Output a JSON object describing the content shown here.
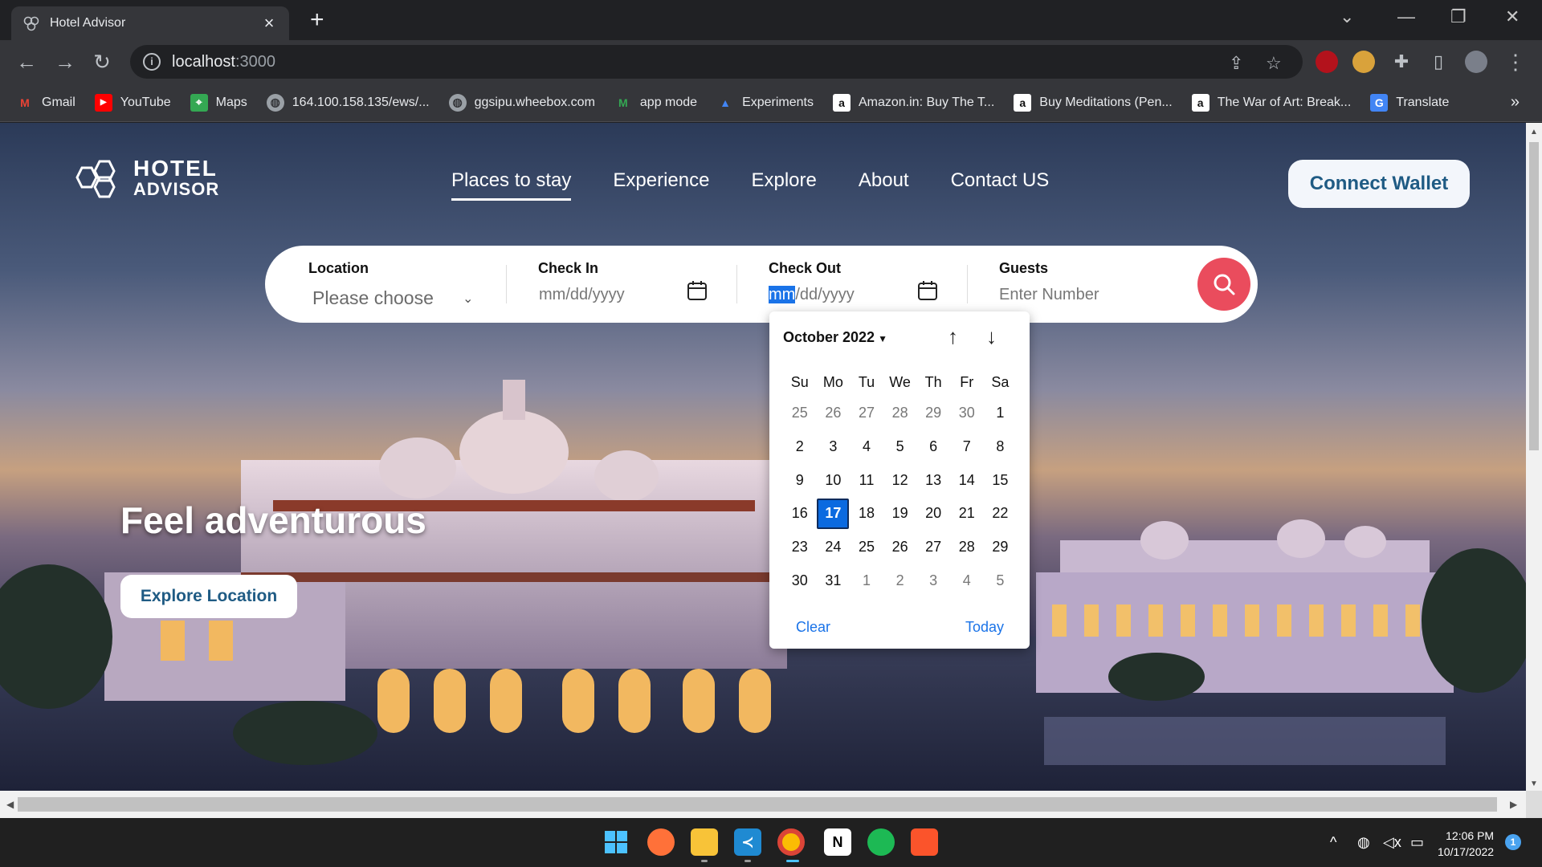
{
  "browser": {
    "tab_title": "Hotel Advisor",
    "url_host": "localhost",
    "url_port": ":3000",
    "bookmarks": [
      {
        "label": "Gmail",
        "icon": "gmail-icon"
      },
      {
        "label": "YouTube",
        "icon": "youtube-icon"
      },
      {
        "label": "Maps",
        "icon": "maps-icon"
      },
      {
        "label": "164.100.158.135/ews/...",
        "icon": "globe-icon"
      },
      {
        "label": "ggsipu.wheebox.com",
        "icon": "globe-icon"
      },
      {
        "label": "app mode",
        "icon": "app-mode-icon"
      },
      {
        "label": "Experiments",
        "icon": "experiments-icon"
      },
      {
        "label": "Amazon.in: Buy The T...",
        "icon": "amazon-icon"
      },
      {
        "label": "Buy Meditations (Pen...",
        "icon": "amazon-icon"
      },
      {
        "label": "The War of Art: Break...",
        "icon": "amazon-icon"
      },
      {
        "label": "Translate",
        "icon": "translate-icon"
      }
    ]
  },
  "site": {
    "logo_line1": "HOTEL",
    "logo_line2": "ADVISOR",
    "nav": [
      "Places to stay",
      "Experience",
      "Explore",
      "About",
      "Contact US"
    ],
    "active_nav": "Places to stay",
    "connect_wallet": "Connect Wallet"
  },
  "search": {
    "location_label": "Location",
    "location_value": "Please choose",
    "checkin_label": "Check In",
    "checkin_value": "mm/dd/yyyy",
    "checkout_label": "Check Out",
    "checkout_mm": "mm",
    "checkout_rest": "/dd/yyyy",
    "guests_label": "Guests",
    "guests_placeholder": "Enter Number"
  },
  "datepicker": {
    "month_label": "October 2022",
    "weekdays": [
      "Su",
      "Mo",
      "Tu",
      "We",
      "Th",
      "Fr",
      "Sa"
    ],
    "weeks": [
      [
        "25",
        "26",
        "27",
        "28",
        "29",
        "30",
        "1"
      ],
      [
        "2",
        "3",
        "4",
        "5",
        "6",
        "7",
        "8"
      ],
      [
        "9",
        "10",
        "11",
        "12",
        "13",
        "14",
        "15"
      ],
      [
        "16",
        "17",
        "18",
        "19",
        "20",
        "21",
        "22"
      ],
      [
        "23",
        "24",
        "25",
        "26",
        "27",
        "28",
        "29"
      ],
      [
        "30",
        "31",
        "1",
        "2",
        "3",
        "4",
        "5"
      ]
    ],
    "selected": "17",
    "clear_label": "Clear",
    "today_label": "Today"
  },
  "hero": {
    "title": "Feel adventurous",
    "cta": "Explore Location"
  },
  "taskbar": {
    "time": "12:06 PM",
    "date": "10/17/2022",
    "notifications": "1"
  },
  "colors": {
    "accent": "#ea4c5d",
    "brand_text": "#1f5b84",
    "selected_day": "#0b6ae0"
  }
}
